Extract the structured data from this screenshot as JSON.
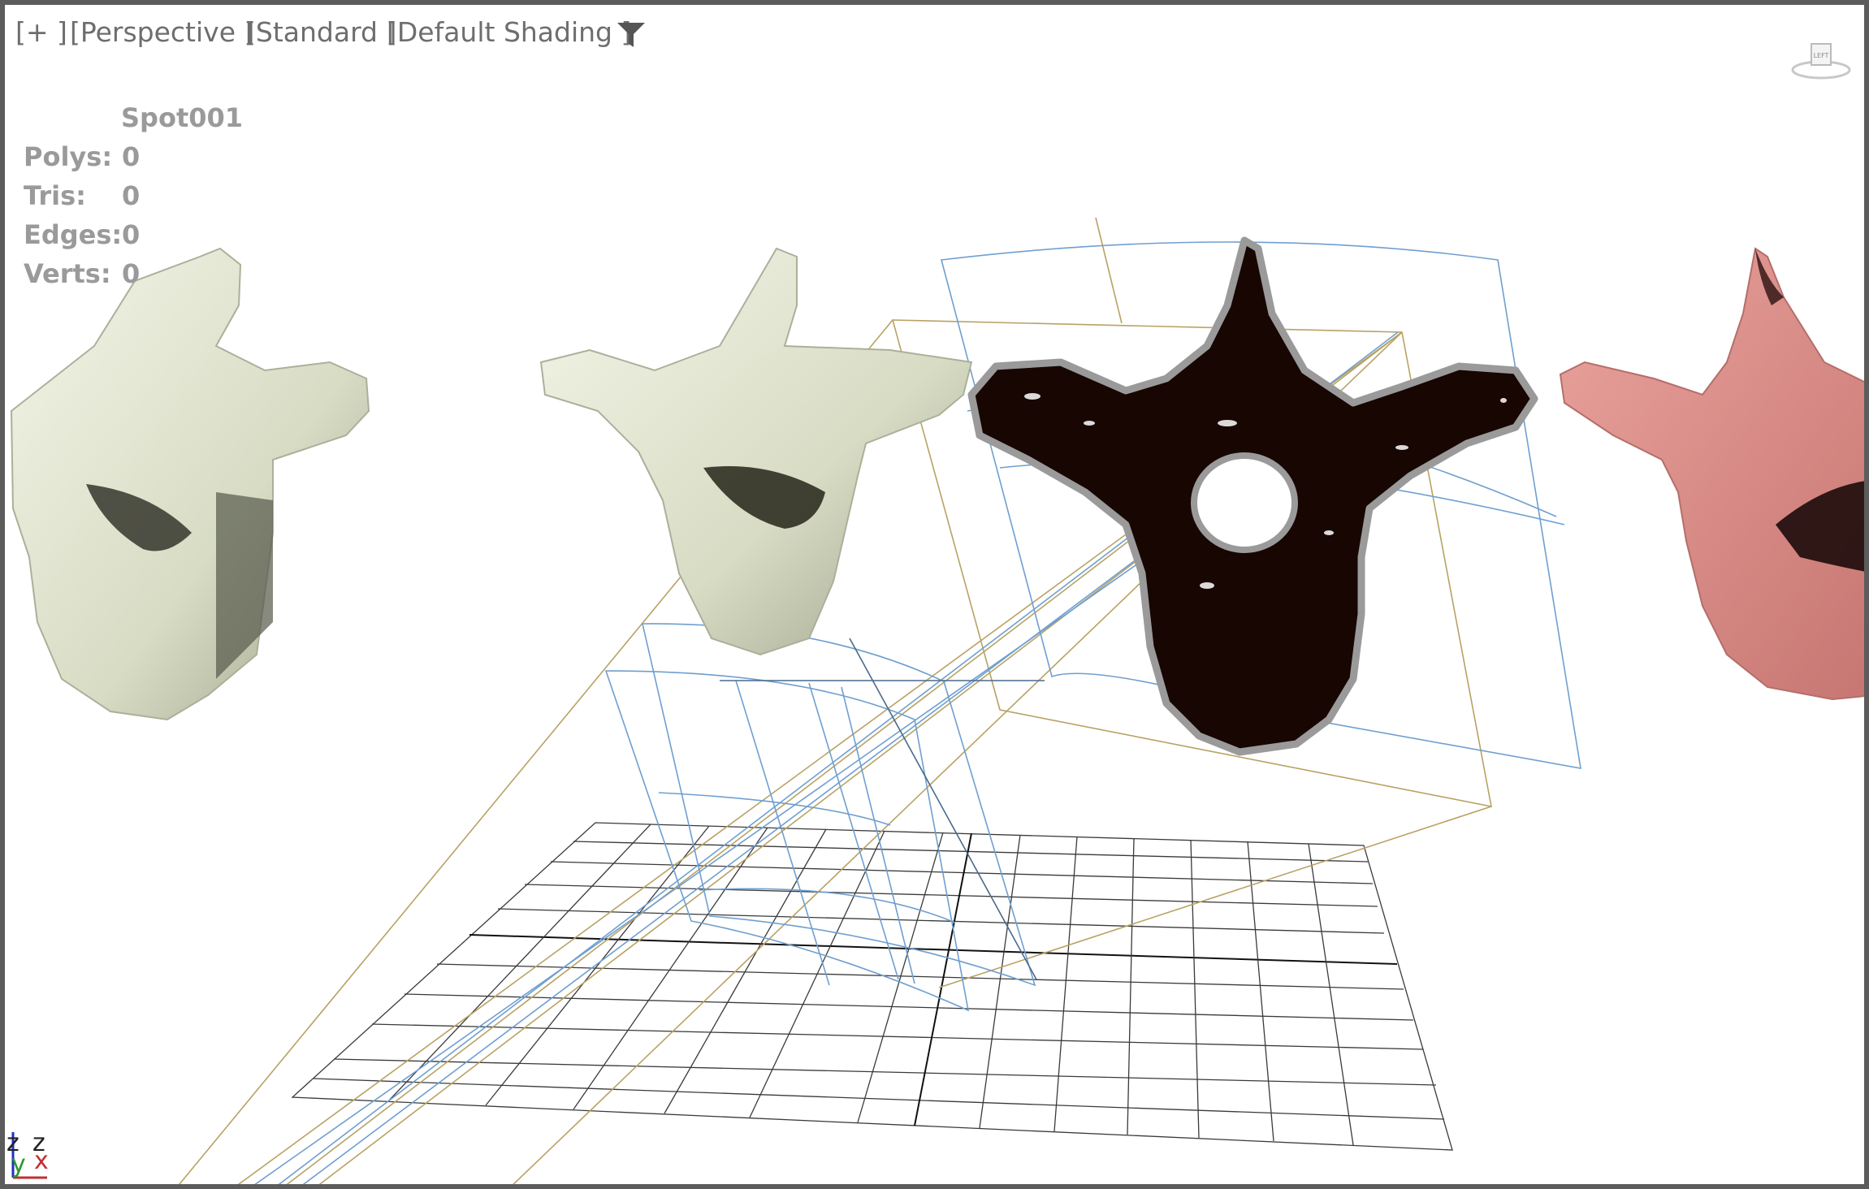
{
  "viewport_menu": {
    "plus_label": "[+ ]",
    "view_label": "[Perspective ]",
    "camera_label": "[Standard ]",
    "shading_label": "[Default Shading ]"
  },
  "icons": {
    "filter": "filter-icon",
    "navcube": "viewcube-icon"
  },
  "navcube": {
    "face_label": "LEFT"
  },
  "stats": {
    "object_name": "Spot001",
    "rows": [
      {
        "label": "Polys:",
        "value": "0"
      },
      {
        "label": "Tris:",
        "value": "0"
      },
      {
        "label": "Edges:",
        "value": "0"
      },
      {
        "label": "Verts:",
        "value": "0"
      }
    ]
  },
  "axis_tripod": {
    "z": "z",
    "y": "y",
    "x": "x"
  },
  "colors": {
    "frame": "#5c5c5c",
    "bone_light": "#dfe4cc",
    "bone_dark": "#170602",
    "bone_pink": "#df8d88",
    "light_gizmo_blue": "#6f9fd0",
    "light_gizmo_gold": "#b8a264",
    "grid": "#333333"
  }
}
